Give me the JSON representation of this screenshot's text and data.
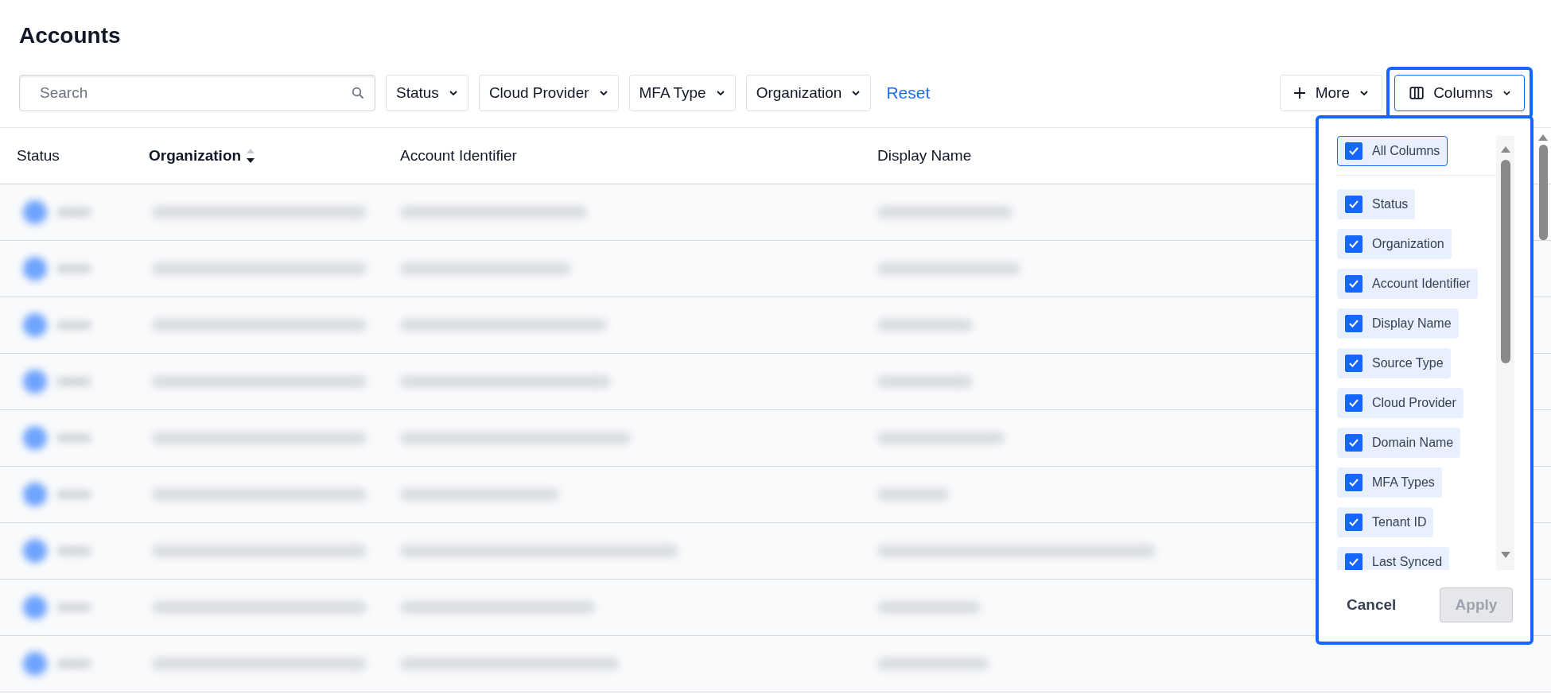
{
  "page": {
    "title": "Accounts"
  },
  "toolbar": {
    "search": {
      "placeholder": "Search"
    },
    "filters": [
      {
        "label": "Status"
      },
      {
        "label": "Cloud Provider"
      },
      {
        "label": "MFA Type"
      },
      {
        "label": "Organization"
      }
    ],
    "reset": "Reset",
    "more": "More",
    "columns": {
      "label": "Columns",
      "expanded": true
    }
  },
  "table": {
    "columns": [
      {
        "label": "Status",
        "sorted": false
      },
      {
        "label": "Organization",
        "sorted": true,
        "descending": true
      },
      {
        "label": "Account Identifier",
        "sorted": false
      },
      {
        "label": "Display Name",
        "sorted": false
      }
    ]
  },
  "column_picker": {
    "all": {
      "label": "All Columns",
      "checked": true
    },
    "items": [
      {
        "label": "Status",
        "checked": true
      },
      {
        "label": "Organization",
        "checked": true
      },
      {
        "label": "Account Identifier",
        "checked": true
      },
      {
        "label": "Display Name",
        "checked": true
      },
      {
        "label": "Source Type",
        "checked": true
      },
      {
        "label": "Cloud Provider",
        "checked": true
      },
      {
        "label": "Domain Name",
        "checked": true
      },
      {
        "label": "MFA Types",
        "checked": true
      },
      {
        "label": "Tenant ID",
        "checked": true
      },
      {
        "label": "Last Synced",
        "checked": true
      }
    ],
    "cancel": "Cancel",
    "apply": {
      "label": "Apply",
      "disabled": true
    }
  }
}
